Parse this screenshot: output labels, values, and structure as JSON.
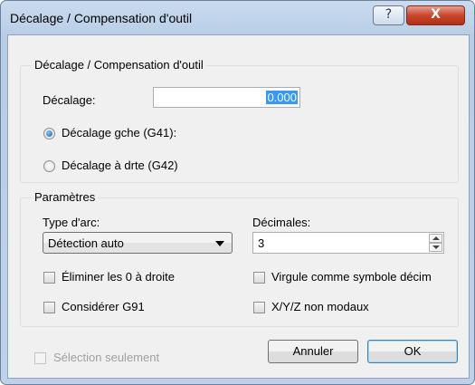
{
  "window": {
    "title": "Décalage / Compensation d'outil",
    "help_label": "?",
    "close_label": "X"
  },
  "offset_group": {
    "title": "Décalage / Compensation d'outil",
    "offset_label": "Décalage:",
    "offset_value": "0.000",
    "radio_left_label": "Décalage gche (G41):",
    "radio_right_label": "Décalage à drte (G42)",
    "selected_radio": "left"
  },
  "params_group": {
    "title": "Paramètres",
    "arc_type_label": "Type d'arc:",
    "arc_type_value": "Détection auto",
    "decimals_label": "Décimales:",
    "decimals_value": "3",
    "check_remove_zeros": "Éliminer les 0 à droite",
    "check_comma": "Virgule comme symbole décim",
    "check_g91": "Considérer G91",
    "check_xyz": "X/Y/Z non modaux"
  },
  "footer": {
    "selection_only_label": "Sélection seulement",
    "cancel_label": "Annuler",
    "ok_label": "OK"
  },
  "colors": {
    "selection_highlight": "#3399ff",
    "close_button": "#c8472b",
    "title_bar": "#c9dbef"
  }
}
